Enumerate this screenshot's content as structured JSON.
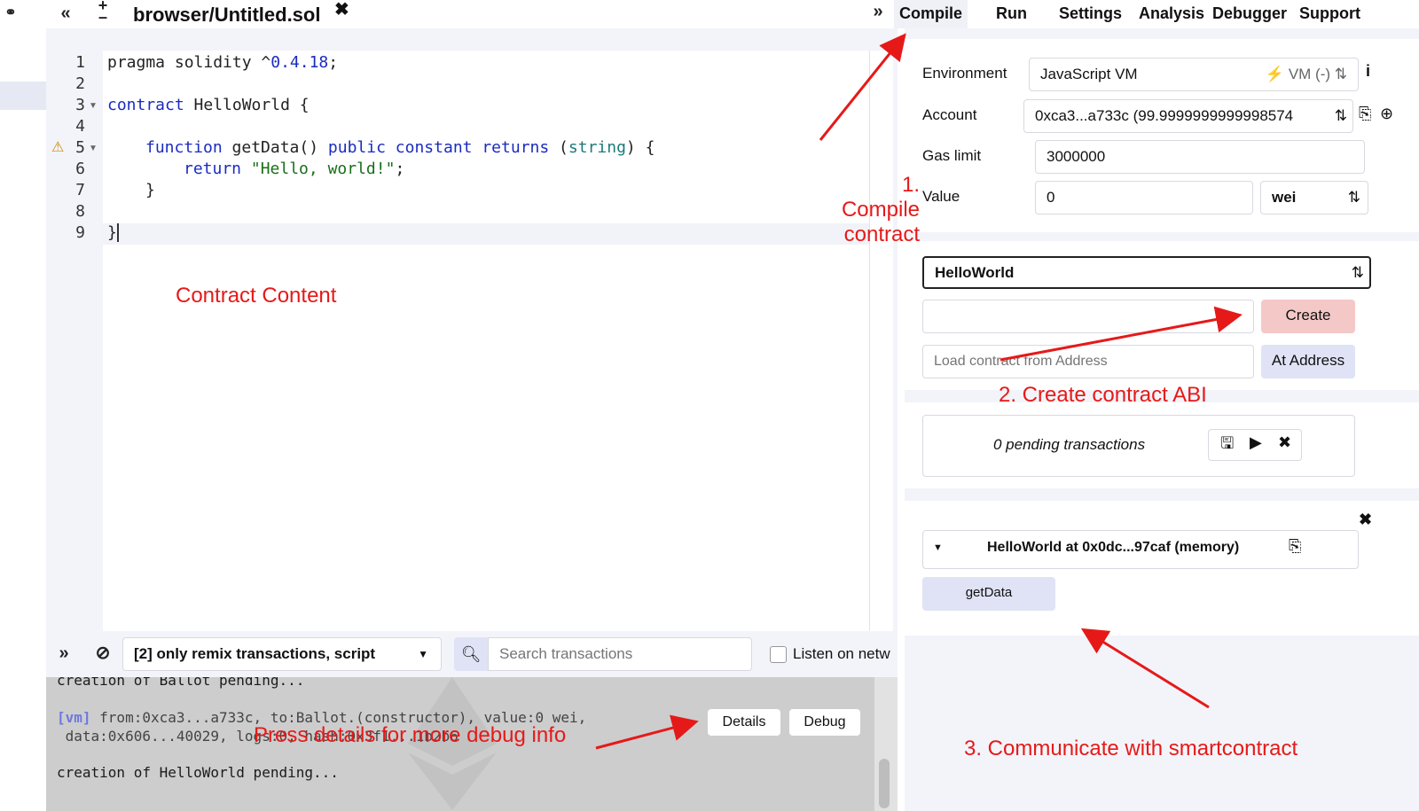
{
  "toolbar": {
    "file_tab": "browser/Untitled.sol"
  },
  "editor": {
    "line_numbers": [
      "1",
      "2",
      "3",
      "4",
      "5",
      "6",
      "7",
      "8",
      "9"
    ],
    "lines": {
      "l1a": "pragma solidity ^",
      "l1b": "0.4.18",
      "l1c": ";",
      "l3a": "contract",
      "l3b": " HelloWorld {",
      "l5a": "function",
      "l5b": " getData() ",
      "l5c": "public",
      "l5d": " ",
      "l5e": "constant",
      "l5f": " ",
      "l5g": "returns",
      "l5h": " (",
      "l5i": "string",
      "l5j": ") {",
      "l6a": "return",
      "l6b": " ",
      "l6c": "\"Hello, world!\"",
      "l6d": ";",
      "l7": "}",
      "l9": "}"
    }
  },
  "tabs": [
    "Compile",
    "Run",
    "Settings",
    "Analysis",
    "Debugger",
    "Support"
  ],
  "run": {
    "environment_label": "Environment",
    "environment_value": "JavaScript VM",
    "vm_badge": "VM (-)",
    "account_label": "Account",
    "account_value": "0xca3...a733c (99.9999999999998574",
    "gas_label": "Gas limit",
    "gas_value": "3000000",
    "value_label": "Value",
    "value_value": "0",
    "value_unit": "wei",
    "contract_select": "HelloWorld",
    "create_button": "Create",
    "load_placeholder": "Load contract from Address",
    "at_address_button": "At Address",
    "pending": "0 pending transactions",
    "instance_title": "HelloWorld at 0x0dc...97caf (memory)",
    "getdata_button": "getData"
  },
  "terminal": {
    "filter": "[2] only remix transactions, script",
    "search_placeholder": "Search transactions",
    "listen_label": "Listen on netw",
    "line1": "creation of Ballot pending...",
    "vm_tag": "[vm]",
    "line2": " from:0xca3...a733c, to:Ballot.(constructor), value:0 wei,",
    "line3": " data:0x606...40029, logs:0, hash:0x3f1...1b2b6",
    "line4": "creation of HelloWorld pending...",
    "details_button": "Details",
    "debug_button": "Debug"
  },
  "annotations": {
    "compile_1": "1. Compile",
    "compile_2": "contract",
    "content": "Contract Content",
    "create_abi": "2. Create contract ABI",
    "communicate": "3. Communicate with smartcontract",
    "details": "Press details for more debug info"
  },
  "colors": {
    "annotation": "#e61919",
    "create_bg": "#f5c8c8",
    "at_address_bg": "#dfe3f5",
    "panel_bg": "#f3f4f9"
  }
}
